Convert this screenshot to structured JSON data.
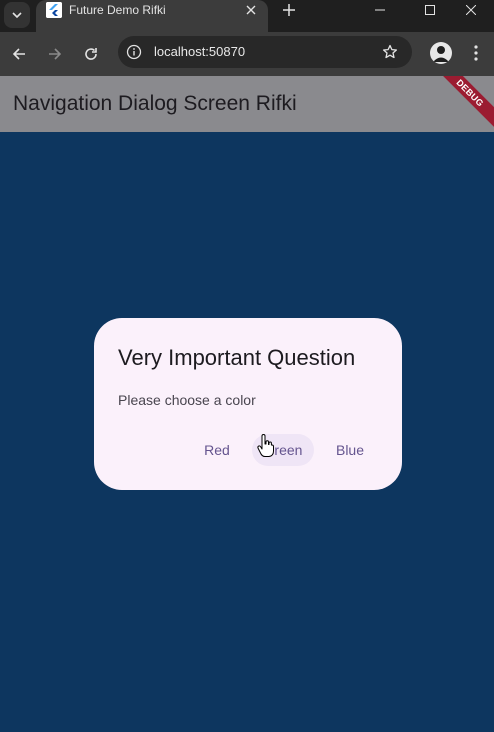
{
  "browser": {
    "tab_title": "Future Demo Rifki",
    "url": "localhost:50870",
    "icons": {
      "tab_search": "chevron-down-icon",
      "favicon": "flutter-icon",
      "tab_close": "close-icon",
      "new_tab": "plus-icon",
      "back": "arrow-left-icon",
      "forward": "arrow-right-icon",
      "reload": "reload-icon",
      "site_info": "info-icon",
      "bookmark": "star-icon",
      "profile": "profile-icon",
      "menu": "kebab-icon"
    }
  },
  "app": {
    "title": "Navigation Dialog Screen Rifki",
    "debug_banner": "DEBUG",
    "background_color": "#0d365f",
    "appbar_color": "#8a8a8e"
  },
  "dialog": {
    "title": "Very Important Question",
    "content": "Please choose a color",
    "buttons": [
      "Red",
      "Green",
      "Blue"
    ],
    "hovered_button": "Green",
    "accent_color": "#65558f"
  }
}
